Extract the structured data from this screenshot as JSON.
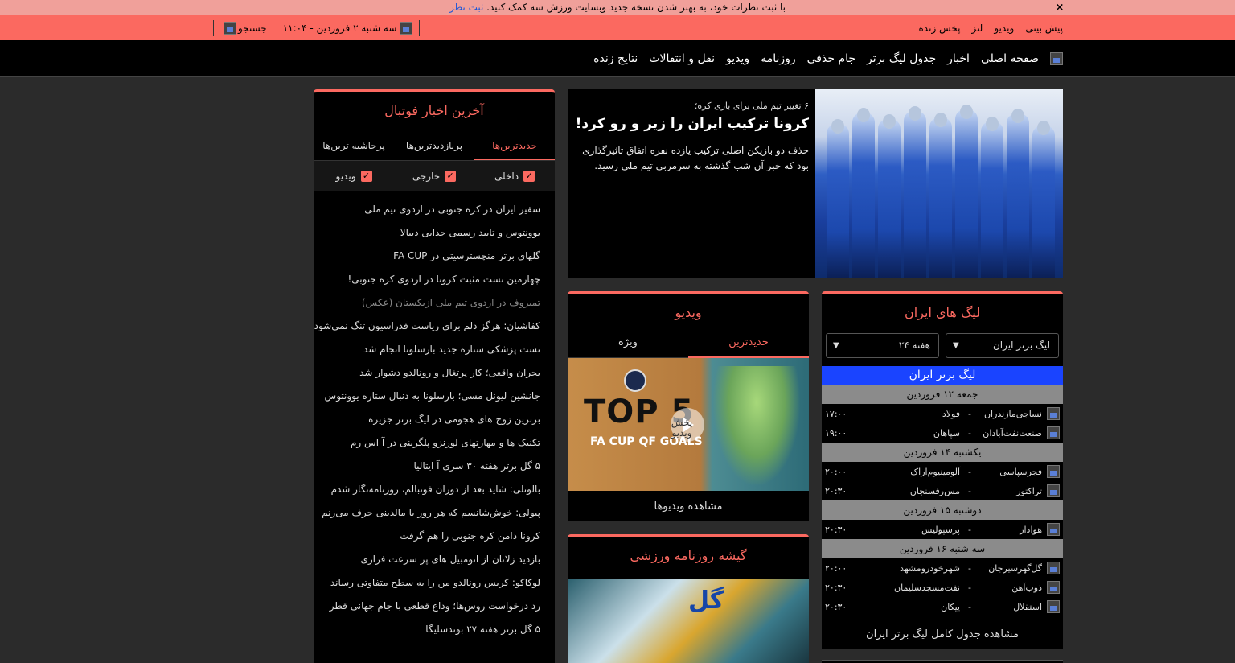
{
  "announcement": {
    "text": "با ثبت نظرات خود، به بهتر شدن نسخه جدید وبسایت ورزش سه کمک کنید.",
    "link": "ثبت نظر",
    "close": "×"
  },
  "topbar": {
    "links": [
      "پیش بینی",
      "ویدیو",
      "لنز",
      "پخش زنده"
    ],
    "date": "سه شنبه ۲ فروردین - ۱۱:۰۴",
    "search": "جستجو"
  },
  "nav": {
    "items": [
      "صفحه اصلی",
      "اخبار",
      "جدول لیگ برتر",
      "جام حذفی",
      "روزنامه",
      "ویدیو",
      "نقل و انتقالات",
      "نتایج زنده"
    ]
  },
  "hero": {
    "kicker": "۶ تغییر تیم ملی برای بازی کره؛",
    "title": "کرونا ترکیب ایران را زیر و رو کرد!",
    "description": "حذف دو بازیکن اصلی ترکیب یازده نفره اتفاق تاثیرگذاری بود که خبر آن شب گذشته به سرمربی تیم ملی رسید."
  },
  "news": {
    "title": "آخرین اخبار فوتبال",
    "tabs": [
      "جدیدترین‌ها",
      "پربازدیدترین‌ها",
      "پرحاشیه ترین‌ها"
    ],
    "filters": [
      "داخلی",
      "خارجی",
      "ویدیو"
    ],
    "items": [
      "سفیر ایران در کره جنوبی در اردوی تیم ملی",
      "یوونتوس و تایید رسمی جدایی دیبالا",
      "گلهای برتر منچسترسیتی در FA CUP",
      "چهارمین تست مثبت کرونا در اردوی کره جنوبی!",
      "تمیروف در اردوی تیم ملی ازبکستان (عکس)",
      "کفاشیان: هرگز دلم برای ریاست فدراسیون تنگ نمی‌شود",
      "تست پزشکی ستاره جدید بارسلونا انجام شد",
      "بحران واقعی؛ کار پرتغال و رونالدو دشوار شد",
      "جانشین لیونل مسی؛ بارسلونا به دنبال ستاره یوونتوس",
      "برترین زوج های هجومی در لیگ برتر جزیره",
      "تکنیک ها و مهارتهای لورنزو پلگرینی در آ اس رم",
      "۵ گل برتر هفته ۳۰ سری آ ایتالیا",
      "بالوتلی: شاید بعد از دوران فوتبالم، روزنامه‌نگار شدم",
      "پیولی: خوش‌شانسم که هر روز با مالدینی حرف می‌زنم",
      "کرونا دامن کره جنوبی را هم گرفت",
      "بازدید زلاتان از اتومبیل های پر سرعت فراری",
      "لوکاکو: کریس رونالدو من را به سطح متفاوتی رساند",
      "رد درخواست روس‌ها؛ وداع قطعی با جام جهانی قطر",
      "۵ گل برتر هفته ۲۷ بوندسلیگا"
    ]
  },
  "video": {
    "title": "ویدیو",
    "tabs": [
      "جدیدترین",
      "ویژه"
    ],
    "thumb_title": "TOP 5",
    "thumb_subtitle": "FA CUP QF GOALS",
    "play_label": "پخش ویدیو",
    "more": "مشاهده ویدیوها"
  },
  "paper": {
    "title": "گیشه روزنامه ورزشی",
    "logo": "گل"
  },
  "leagues": {
    "title": "لیگ های ایران",
    "league_select": "لیگ برتر ایران",
    "week_select": "هفته ۲۴",
    "league_name": "لیگ برتر ایران",
    "days": [
      {
        "label": "جمعه ۱۲ فروردین",
        "matches": [
          {
            "home": "نساجی‌مازندران",
            "away": "فولاد",
            "time": "۱۷:۰۰"
          },
          {
            "home": "صنعت‌نفت‌آبادان",
            "away": "سپاهان",
            "time": "۱۹:۰۰"
          }
        ]
      },
      {
        "label": "یکشنبه ۱۴ فروردین",
        "matches": [
          {
            "home": "فجرسپاسی",
            "away": "آلومینیوم‌اراک",
            "time": "۲۰:۰۰"
          },
          {
            "home": "تراکتور",
            "away": "مس‌رفسنجان",
            "time": "۲۰:۳۰"
          }
        ]
      },
      {
        "label": "دوشنبه ۱۵ فروردین",
        "matches": [
          {
            "home": "هوادار",
            "away": "پرسپولیس",
            "time": "۲۰:۳۰"
          }
        ]
      },
      {
        "label": "سه شنبه ۱۶ فروردین",
        "matches": [
          {
            "home": "گل‌گهرسیرجان",
            "away": "شهرخودرومشهد",
            "time": "۲۰:۰۰"
          },
          {
            "home": "ذوب‌آهن",
            "away": "نفت‌مسجدسلیمان",
            "time": "۲۰:۳۰"
          },
          {
            "home": "استقلال",
            "away": "پیکان",
            "time": "۲۰:۳۰"
          }
        ]
      }
    ],
    "dash": "-",
    "more": "مشاهده جدول کامل لیگ برتر ایران"
  },
  "colors": {
    "accent": "#fb6960",
    "announce_bg": "#f0a09a",
    "league_header": "#1a44ff",
    "day_header": "#8b8b8b",
    "background": "#2b2b2b"
  }
}
